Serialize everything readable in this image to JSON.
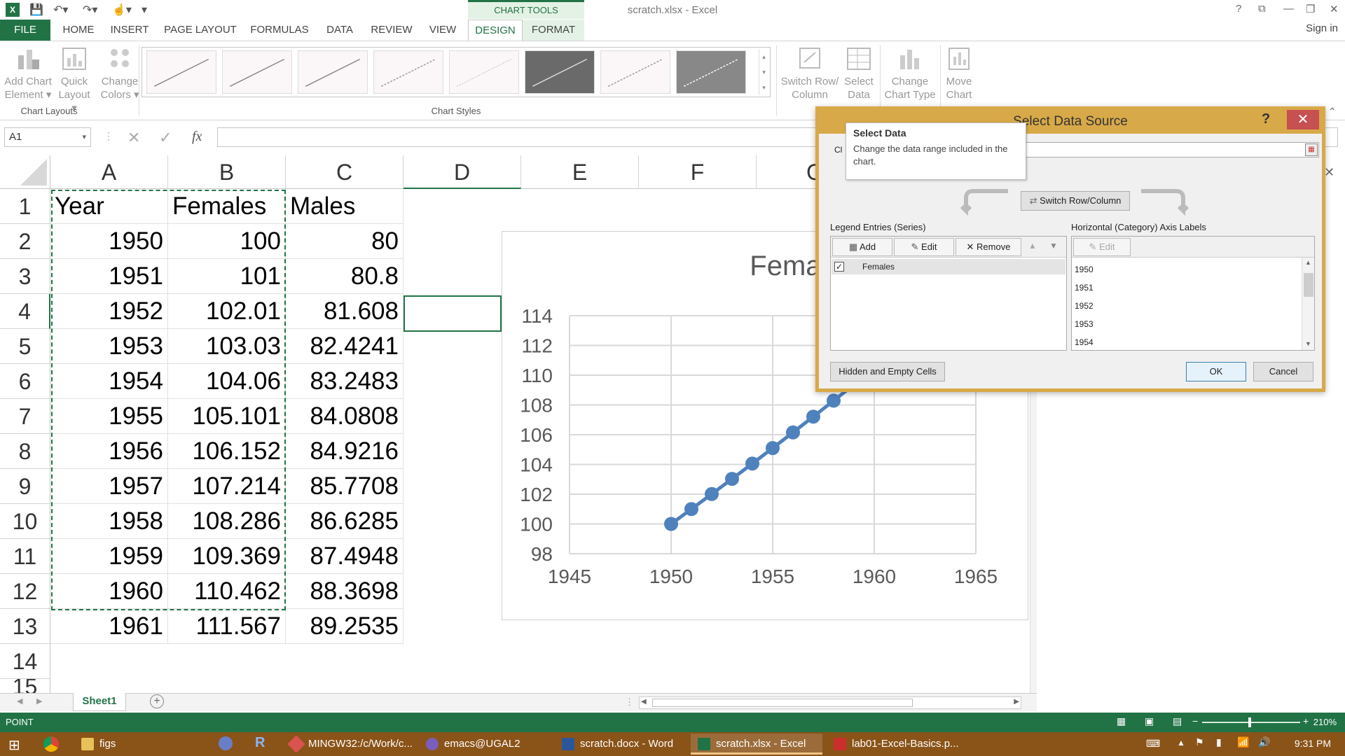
{
  "window": {
    "title": "scratch.xlsx - Excel",
    "context_tab": "CHART TOOLS",
    "help": "?",
    "sign_in": "Sign in"
  },
  "tabs": [
    "FILE",
    "HOME",
    "INSERT",
    "PAGE LAYOUT",
    "FORMULAS",
    "DATA",
    "REVIEW",
    "VIEW",
    "DESIGN",
    "FORMAT"
  ],
  "ribbon": {
    "add_chart_element": "Add Chart Element",
    "quick_layout": "Quick Layout",
    "change_colors": "Change Colors",
    "chart_layouts": "Chart Layouts",
    "chart_styles": "Chart Styles",
    "switch_row_column": "Switch Row/ Column",
    "select_data": "Select Data",
    "change_chart_type": "Change Chart Type",
    "move_chart": "Move Chart"
  },
  "formula_bar": {
    "name_box": "A1",
    "fx": "fx",
    "value": ""
  },
  "grid": {
    "columns": [
      "A",
      "B",
      "C",
      "D",
      "E",
      "F",
      "G"
    ],
    "rows": [
      "1",
      "2",
      "3",
      "4",
      "5",
      "6",
      "7",
      "8",
      "9",
      "10",
      "11",
      "12",
      "13",
      "14",
      "15"
    ],
    "headers": [
      "Year",
      "Females",
      "Males"
    ],
    "data": [
      [
        "1950",
        "100",
        "80"
      ],
      [
        "1951",
        "101",
        "80.8"
      ],
      [
        "1952",
        "102.01",
        "81.608"
      ],
      [
        "1953",
        "103.03",
        "82.4241"
      ],
      [
        "1954",
        "104.06",
        "83.2483"
      ],
      [
        "1955",
        "105.101",
        "84.0808"
      ],
      [
        "1956",
        "106.152",
        "84.9216"
      ],
      [
        "1957",
        "107.214",
        "85.7708"
      ],
      [
        "1958",
        "108.286",
        "86.6285"
      ],
      [
        "1959",
        "109.369",
        "87.4948"
      ],
      [
        "1960",
        "110.462",
        "88.3698"
      ],
      [
        "1961",
        "111.567",
        "89.2535"
      ]
    ]
  },
  "chart_data": {
    "type": "scatter",
    "title": "Females",
    "x": [
      1950,
      1951,
      1952,
      1953,
      1954,
      1955,
      1956,
      1957,
      1958,
      1959
    ],
    "series": [
      {
        "name": "Females",
        "values": [
          100,
          101,
          102.01,
          103.03,
          104.06,
          105.101,
          106.152,
          107.214,
          108.286,
          109.369
        ]
      }
    ],
    "xlim": [
      1945,
      1965
    ],
    "ylim": [
      98,
      114
    ],
    "x_ticks": [
      "1945",
      "1950",
      "1955",
      "1960",
      "1965"
    ],
    "y_ticks": [
      "98",
      "100",
      "102",
      "104",
      "106",
      "108",
      "110",
      "112",
      "114"
    ],
    "grid": true,
    "color": "#4f81bd"
  },
  "dialog": {
    "title": "Select Data Source",
    "chart_range_label": "Cl",
    "tooltip_title": "Select Data",
    "tooltip_text": "Change the data range included in the chart.",
    "switch": "Switch Row/Column",
    "legend_label": "Legend Entries (Series)",
    "axis_label": "Horizontal (Category) Axis Labels",
    "add": "Add",
    "edit": "Edit",
    "remove": "Remove",
    "axis_edit": "Edit",
    "series": [
      "Females"
    ],
    "axis_items": [
      "1950",
      "1951",
      "1952",
      "1953",
      "1954"
    ],
    "hidden_cells": "Hidden and Empty Cells",
    "ok": "OK",
    "cancel": "Cancel"
  },
  "sheet": {
    "tab": "Sheet1",
    "status": "POINT",
    "zoom": "210%"
  },
  "taskbar": {
    "items": [
      "figs",
      "MINGW32:/c/Work/c...",
      "emacs@UGAL2",
      "scratch.docx - Word",
      "scratch.xlsx - Excel",
      "lab01-Excel-Basics.p..."
    ],
    "clock": "9:31 PM"
  }
}
